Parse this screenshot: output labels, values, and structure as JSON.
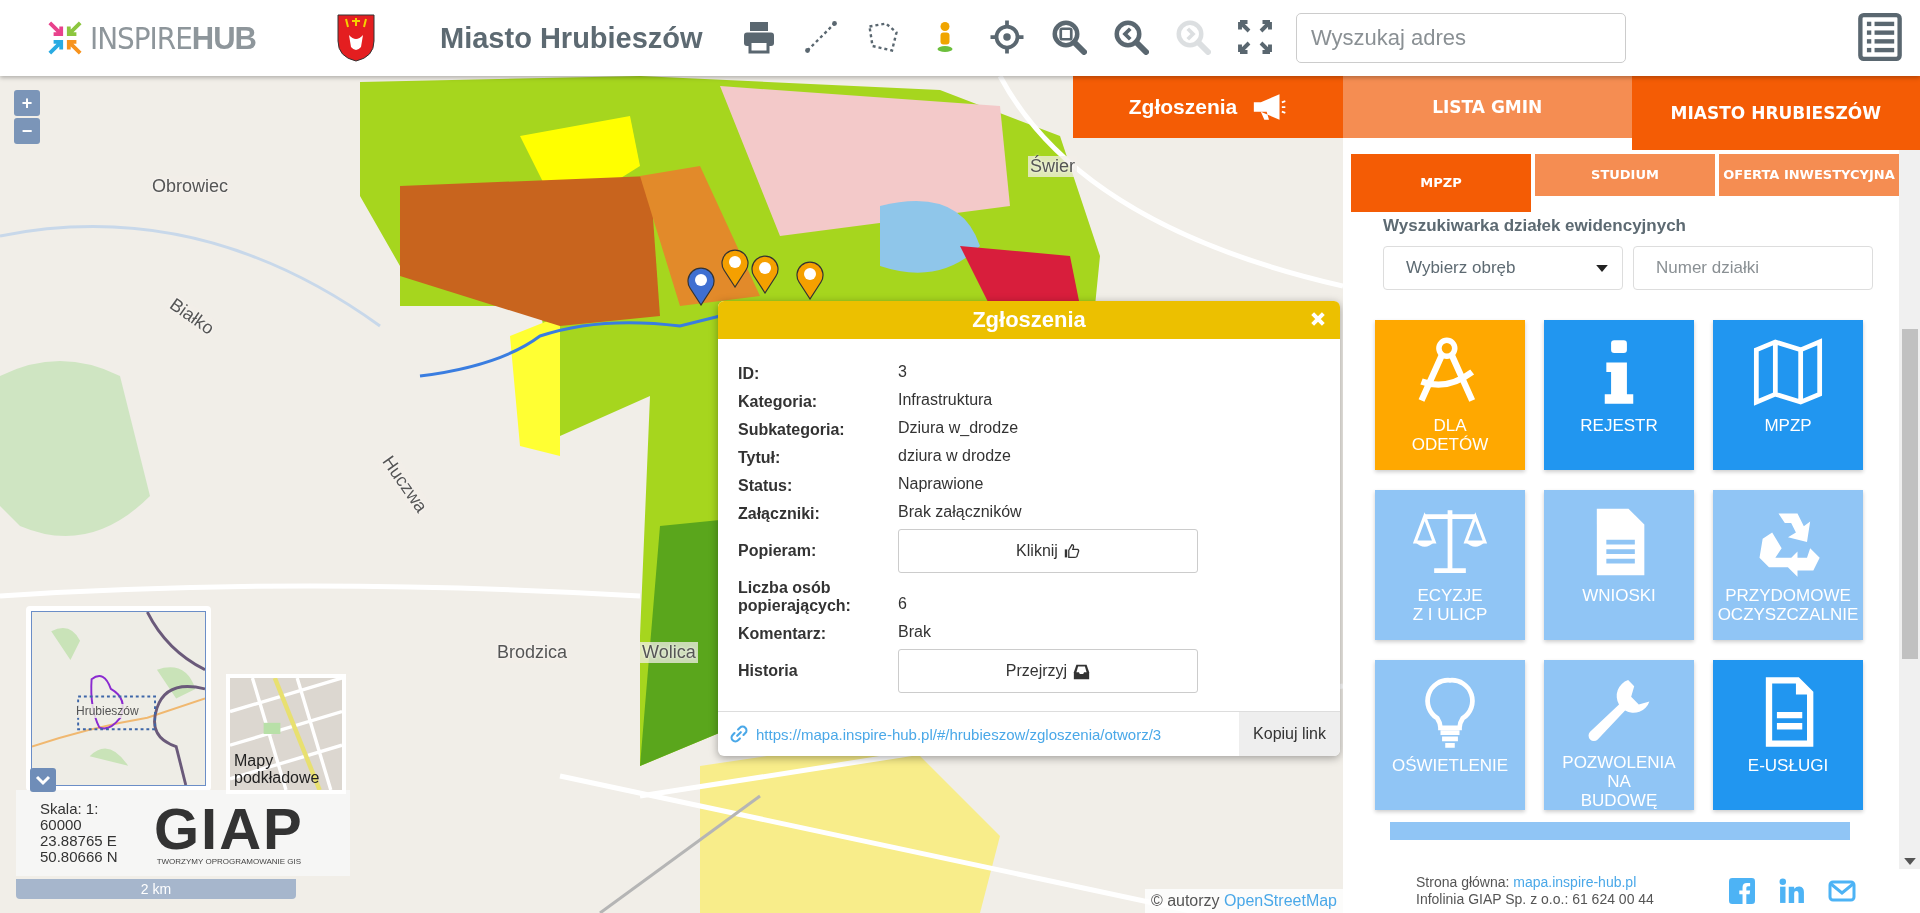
{
  "header": {
    "logo": {
      "part_1": "INSPIRE",
      "part_2": "HUB"
    },
    "title": "Miasto Hrubieszów",
    "toolbar": [
      {
        "kind": "print",
        "disabled": false
      },
      {
        "kind": "line",
        "disabled": false
      },
      {
        "kind": "area",
        "disabled": false
      },
      {
        "kind": "person",
        "disabled": false
      },
      {
        "kind": "locate",
        "disabled": false
      },
      {
        "kind": "extent",
        "disabled": false
      },
      {
        "kind": "back",
        "disabled": false
      },
      {
        "kind": "forward",
        "disabled": true
      },
      {
        "kind": "fullscreen",
        "disabled": false
      }
    ],
    "search": {
      "placeholder": "Wyszukaj adres"
    }
  },
  "map": {
    "zoom_buttons": [
      "+",
      "−"
    ],
    "labels": [
      "Obrowiec",
      "Świer",
      "Białko",
      "Huczwa",
      "Brodzica",
      "Wolica"
    ],
    "markers": [
      {
        "color": "#3f6fd1"
      },
      {
        "color": "#f5a000"
      },
      {
        "color": "#f5a000"
      },
      {
        "color": "#f5a000"
      }
    ]
  },
  "report_button": {
    "label": "Zgłoszenia"
  },
  "popup": {
    "title": "Zgłoszenia",
    "rows": [
      {
        "kind": "text",
        "label": "ID:",
        "value": "3"
      },
      {
        "kind": "text",
        "label": "Kategoria:",
        "value": "Infrastruktura"
      },
      {
        "kind": "text",
        "label": "Subkategoria:",
        "value": "Dziura w_drodze"
      },
      {
        "kind": "text",
        "label": "Tytuł:",
        "value": "dziura w drodze"
      },
      {
        "kind": "text",
        "label": "Status:",
        "value": "Naprawione"
      },
      {
        "kind": "text",
        "label": "Załączniki:",
        "value": "Brak załączników"
      },
      {
        "kind": "like",
        "label": "Popieram:",
        "value": "Kliknij"
      },
      {
        "kind": "text",
        "label": "Liczba osób popierających:",
        "value": "6"
      },
      {
        "kind": "text",
        "label": "Komentarz:",
        "value": "Brak"
      },
      {
        "kind": "history",
        "label": "Historia",
        "value": "Przejrzyj"
      }
    ],
    "link": "https://mapa.inspire-hub.pl/#/hrubieszow/zgloszenia/otworz/3",
    "copy_button": "Kopiuj link"
  },
  "panel": {
    "tabs": [
      {
        "label": "LISTA GMIN",
        "selected": false
      },
      {
        "label": "MIASTO HRUBIESZÓW",
        "selected": true
      }
    ],
    "subtabs": [
      {
        "label": "MPZP",
        "selected": true
      },
      {
        "label": "STUDIUM",
        "selected": false
      },
      {
        "label": "OFERTA INWESTYCYJNA",
        "selected": false
      }
    ],
    "parcel_search": {
      "heading": "Wyszukiwarka działek ewidencyjnych",
      "precinct_select": {
        "value": "Wybierz obręb"
      },
      "parcel_number": {
        "placeholder": "Numer działki"
      }
    },
    "tiles": [
      {
        "kind": "compass",
        "lines": [
          "DLA",
          "ODETÓW"
        ],
        "color": "#ffa800"
      },
      {
        "kind": "info",
        "lines": [
          "REJESTR"
        ],
        "color": "#2196f0"
      },
      {
        "kind": "map",
        "lines": [
          "MPZP"
        ],
        "color": "#2196f0"
      },
      {
        "kind": "scales",
        "lines": [
          "ECYZJE",
          "Z I ULICP"
        ],
        "color": "#90c5f5"
      },
      {
        "kind": "document",
        "lines": [
          "WNIOSKI"
        ],
        "color": "#90c5f5"
      },
      {
        "kind": "recycle",
        "lines": [
          "PRZYDOMOWE",
          "OCZYSZCZALNIE"
        ],
        "color": "#90c5f5"
      },
      {
        "kind": "bulb",
        "lines": [
          "OŚWIETLENIE"
        ],
        "color": "#90c5f5"
      },
      {
        "kind": "wrench",
        "lines": [
          "POZWOLENIA",
          "NA",
          "BUDOWĘ"
        ],
        "color": "#90c5f5"
      },
      {
        "kind": "form",
        "lines": [
          "E-USŁUGI"
        ],
        "color": "#2196f0"
      }
    ],
    "footer": {
      "home_label": "Strona główna:",
      "home_link": "mapa.inspire-hub.pl",
      "hotline": "Infolinia GIAP Sp. z o.o.: 61 624 00 44"
    }
  },
  "overview": {
    "place": "Hrubieszów",
    "basemap_label": "Mapy podkładowe"
  },
  "info_box": {
    "scale": "Skala: 1: 60000",
    "lon": "23.88765 E",
    "lat": "50.80666 N",
    "logo": "GIAP",
    "tagline": "TWORZYMY OPROGRAMOWANIE GIS"
  },
  "scale_bar": "2 km",
  "attribution": {
    "text": "© autorzy",
    "link": "OpenStreetMap"
  }
}
